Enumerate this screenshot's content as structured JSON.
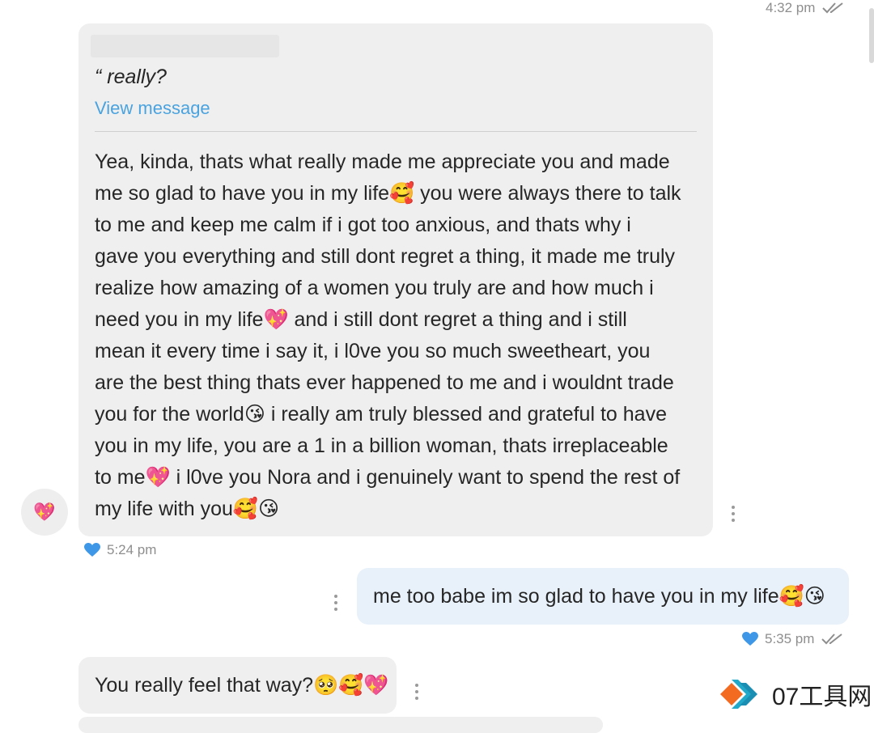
{
  "header_meta": {
    "time": "4:32 pm"
  },
  "message1": {
    "reply_quote": "“ really?",
    "view_message": "View message",
    "text": "Yea, kinda, thats what really made me appreciate you and made\nme so glad to have you in my life🥰 you were always there to talk\nto me and keep me calm if i got too anxious, and thats why i\ngave you everything and still dont regret a thing, it made me truly\nrealize how amazing of a women you truly are and how much i\nneed you in my life💖 and i still dont regret a thing and i still\nmean it every time i say it, i l0ve you so much sweetheart, you\nare the best thing thats ever happened to me and i wouldnt trade\nyou for the world😘 i really am truly blessed and grateful to have\nyou in my life, you are a 1 in a billion woman, thats irreplaceable\nto me💖 i l0ve you Nora and i genuinely want to spend the rest of\nmy life with you🥰😘",
    "time": "5:24 pm",
    "avatar_emoji": "💖"
  },
  "message2": {
    "text": "me too babe im so glad to have you in my life🥰😘",
    "time": "5:35 pm"
  },
  "message3": {
    "text": "You really feel that way?🥺🥰💖"
  },
  "watermark": {
    "text": "07工具网"
  },
  "colors": {
    "incoming_bubble": "#efefef",
    "outgoing_bubble": "#e8f1fa",
    "link": "#4aa3df",
    "heart": "#3f97e8"
  }
}
